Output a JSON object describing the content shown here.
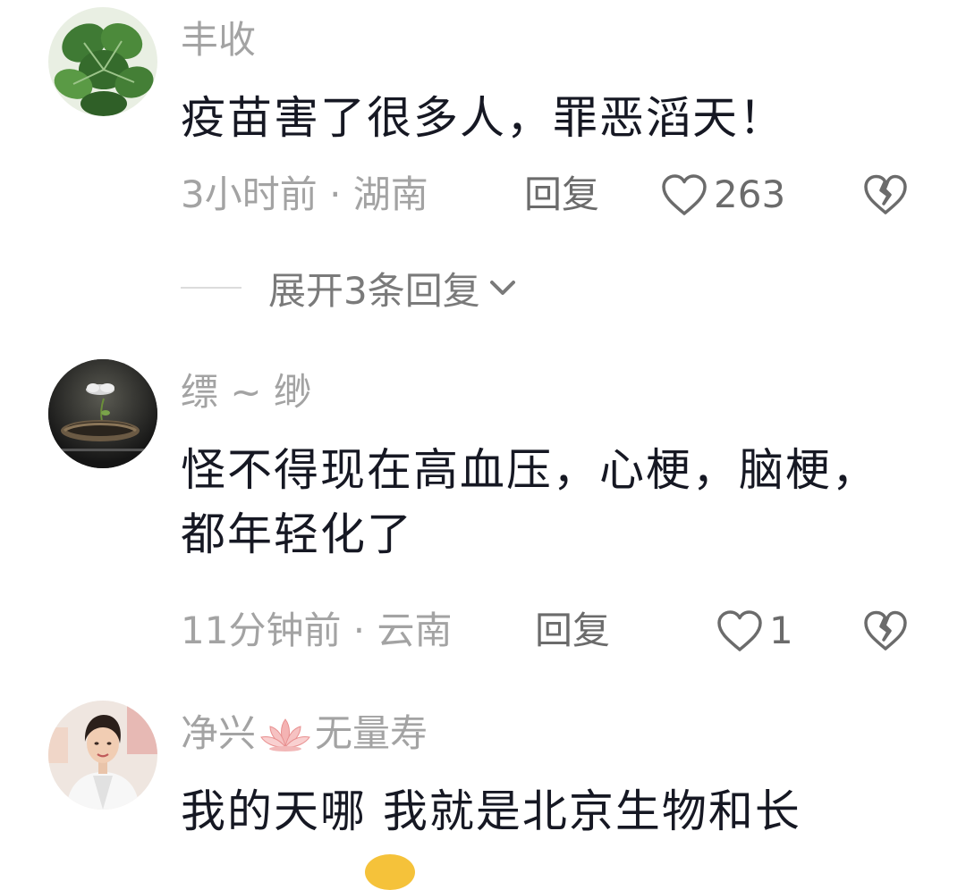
{
  "comments": [
    {
      "username": "丰收",
      "text": "疫苗害了很多人，罪恶滔天！",
      "time_location": "3小时前 · 湖南",
      "reply_label": "回复",
      "likes": "263",
      "expand_label": "展开3条回复"
    },
    {
      "username": "缥 ~ 缈",
      "text": "怪不得现在高血压，心梗，脑梗，都年轻化了",
      "time_location": "11分钟前 · 云南",
      "reply_label": "回复",
      "likes": "1"
    },
    {
      "username_part1": "净兴",
      "username_part2": "无量寿",
      "text": "我的天哪 我就是北京生物和长"
    }
  ],
  "colors": {
    "text_primary": "#161823",
    "text_secondary": "#a3a3a3",
    "action_text": "#6b6b6b"
  },
  "icons": {
    "like": "heart-outline-icon",
    "dislike": "broken-heart-icon",
    "expand": "chevron-down-icon",
    "lotus": "lotus-icon"
  }
}
